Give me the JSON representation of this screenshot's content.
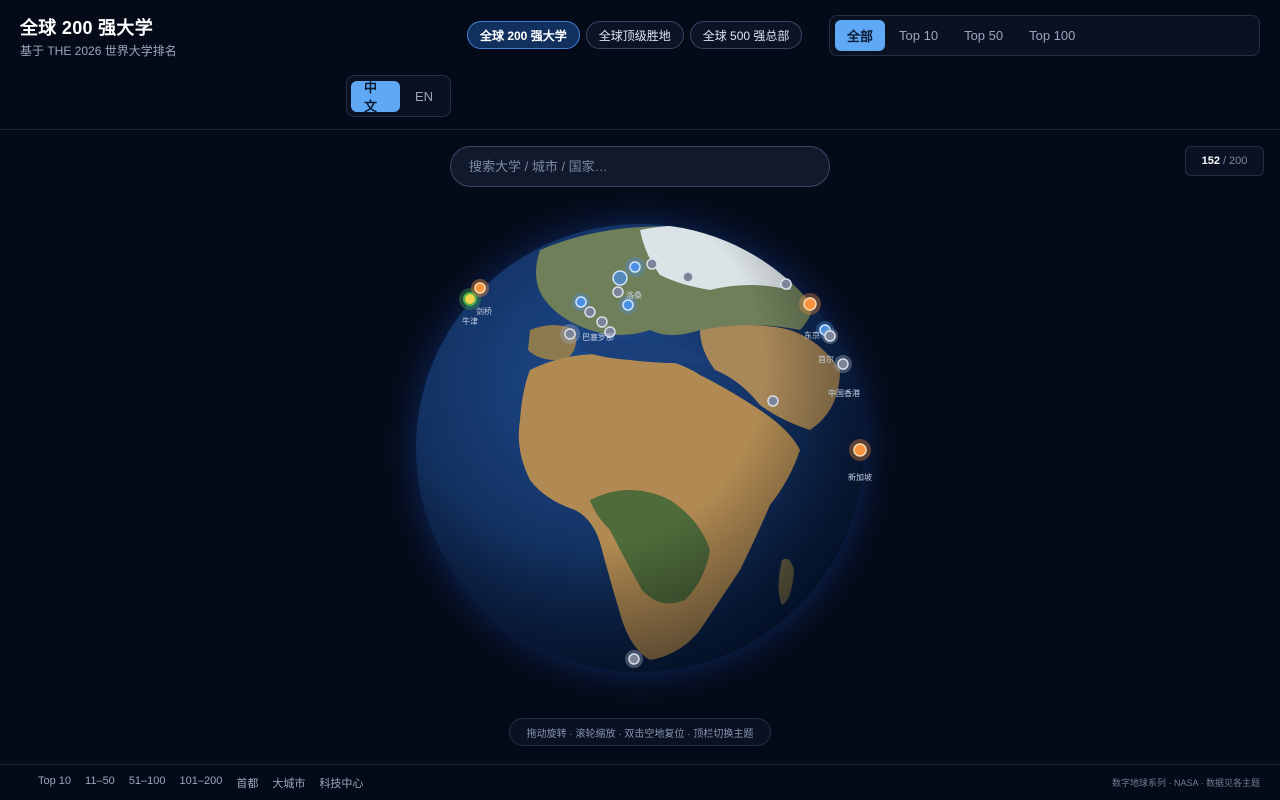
{
  "app": {
    "title": "全球 200 强大学",
    "subtitle": "基于 THE 2026 世界大学排名"
  },
  "theme_tabs": [
    {
      "label": "全球 200 强大学",
      "active": true
    },
    {
      "label": "全球顶级胜地",
      "active": false
    },
    {
      "label": "全球 500 强总部",
      "active": false
    }
  ],
  "rank_filter": [
    {
      "label": "全部",
      "active": true
    },
    {
      "label": "Top 10",
      "active": false
    },
    {
      "label": "Top 50",
      "active": false
    },
    {
      "label": "Top 100",
      "active": false
    }
  ],
  "language": [
    {
      "label": "中文",
      "active": true
    },
    {
      "label": "EN",
      "active": false
    }
  ],
  "search": {
    "placeholder": "搜索大学 / 城市 / 国家…"
  },
  "counter": {
    "current": "152",
    "total": "/ 200"
  },
  "colors": {
    "accent": "#5fa8f5",
    "tier_top10": "#4caf50",
    "tier_11_50": "#f5923e",
    "tier_51_100": "#4a90e2",
    "tier_101_200": "#9aa4b8",
    "ocean": "#16336a",
    "land": "#9c7844",
    "snow": "#e8eef6"
  },
  "globe": {
    "city_labels": [
      "牛津",
      "剑桥",
      "洛桑",
      "中国香港",
      "新加坡",
      "首尔",
      "东京",
      "巴塞罗那"
    ]
  },
  "hint": "拖动旋转 · 滚轮缩放 · 双击空地复位 · 顶栏切换主题",
  "legend": [
    "Top 10",
    "11–50",
    "51–100",
    "101–200",
    "首都",
    "大城市",
    "科技中心"
  ],
  "credit": "数字地球系列 · NASA · 数据见各主题"
}
